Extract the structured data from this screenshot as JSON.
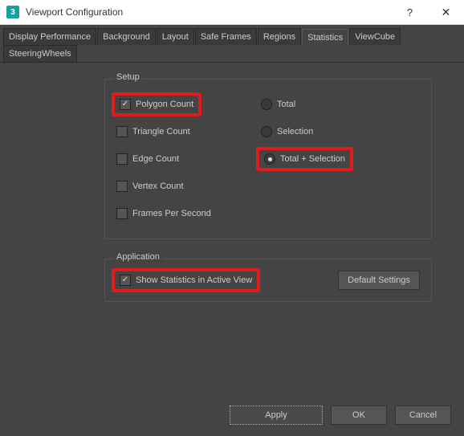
{
  "window": {
    "title": "Viewport Configuration",
    "app_icon_text": "3"
  },
  "tabs": [
    "Display Performance",
    "Background",
    "Layout",
    "Safe Frames",
    "Regions",
    "Statistics",
    "ViewCube",
    "SteeringWheels"
  ],
  "active_tab_index": 5,
  "setup": {
    "title": "Setup",
    "checks": {
      "polygon": "Polygon Count",
      "triangle": "Triangle Count",
      "edge": "Edge Count",
      "vertex": "Vertex Count",
      "fps": "Frames Per Second"
    },
    "radios": {
      "total": "Total",
      "selection": "Selection",
      "total_selection": "Total + Selection"
    }
  },
  "application": {
    "title": "Application",
    "show_stats": "Show Statistics in Active View",
    "default_btn": "Default Settings"
  },
  "footer": {
    "apply": "Apply",
    "ok": "OK",
    "cancel": "Cancel"
  }
}
